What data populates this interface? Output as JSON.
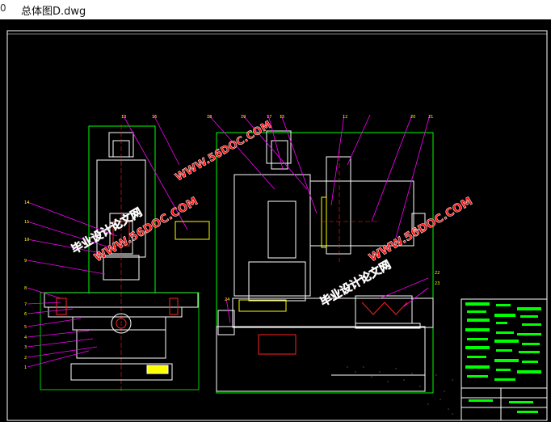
{
  "window": {
    "title": "总体图D.dwg",
    "edge_glyph": "0"
  },
  "watermarks": {
    "left_cn": "毕业设计论文网",
    "left_url": "WWW.56DOC.COM",
    "right_cn": "毕业设计论文网",
    "right_url": "WWW.56DOC.COM",
    "top_url": "WWW.56DOC.COM"
  },
  "part_numbers": {
    "left_stack": [
      "14",
      "11",
      "10",
      "9",
      "8",
      "7",
      "6",
      "5",
      "4",
      "3",
      "2",
      "1"
    ],
    "top_left": [
      "13",
      "16"
    ],
    "top_right": [
      "18",
      "19",
      "17",
      "15",
      "12",
      "20",
      "21"
    ],
    "right_side": [
      "22",
      "23"
    ],
    "bottom_left": [
      "24"
    ]
  },
  "colors": {
    "background": "#000000",
    "outline": "#ffffff",
    "green": "#00ff00",
    "magenta": "#ff00ff",
    "red": "#ff2020",
    "yellow": "#ffff00",
    "watermark": "#ff1010"
  }
}
